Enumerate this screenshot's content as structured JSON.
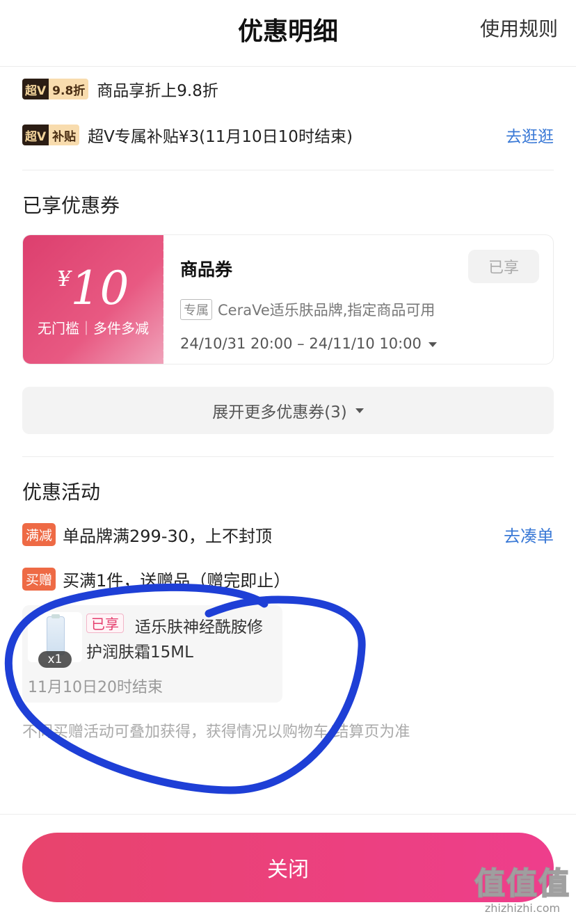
{
  "header": {
    "title": "优惠明细",
    "rules_link": "使用规则"
  },
  "vip": {
    "rows": [
      {
        "badge_left": "超V",
        "badge_right": "9.8折",
        "text": "商品享折上9.8折",
        "link": ""
      },
      {
        "badge_left": "超V",
        "badge_right": "补贴",
        "text": "超V专属补贴¥3(11月10日10时结束)",
        "link": "去逛逛"
      }
    ]
  },
  "coupons_section": {
    "title": "已享优惠券",
    "coupon": {
      "currency": "¥",
      "amount": "10",
      "condition": "无门槛｜多件多减",
      "name": "商品券",
      "status": "已享",
      "tag": "专属",
      "description": "CeraVe适乐肤品牌,指定商品可用",
      "validity": "24/10/31 20:00 – 24/11/10 10:00"
    },
    "expand_label": "展开更多优惠券(3)"
  },
  "activities_section": {
    "title": "优惠活动",
    "rows": [
      {
        "badge": "满减",
        "text": "单品牌满299-30，上不封顶",
        "link": "去凑单"
      },
      {
        "badge": "买赠",
        "text": "买满1件，送赠品（赠完即止）",
        "link": ""
      }
    ],
    "gift": {
      "status_tag": "已享",
      "name_line1": "适乐肤神经酰胺修",
      "name_line2": "护润肤霜15ML",
      "quantity": "x1",
      "end_time": "11月10日20时结束"
    },
    "note": "不同买赠活动可叠加获得，获得情况以购物车/结算页为准"
  },
  "footer": {
    "close_label": "关闭"
  },
  "watermark": {
    "logo_text": "值值值",
    "site": "zhizhizhi.com"
  },
  "colors": {
    "accent_pink": "#e8446c",
    "link_blue": "#3a79d6",
    "annotation_blue": "#1e3fd6"
  }
}
